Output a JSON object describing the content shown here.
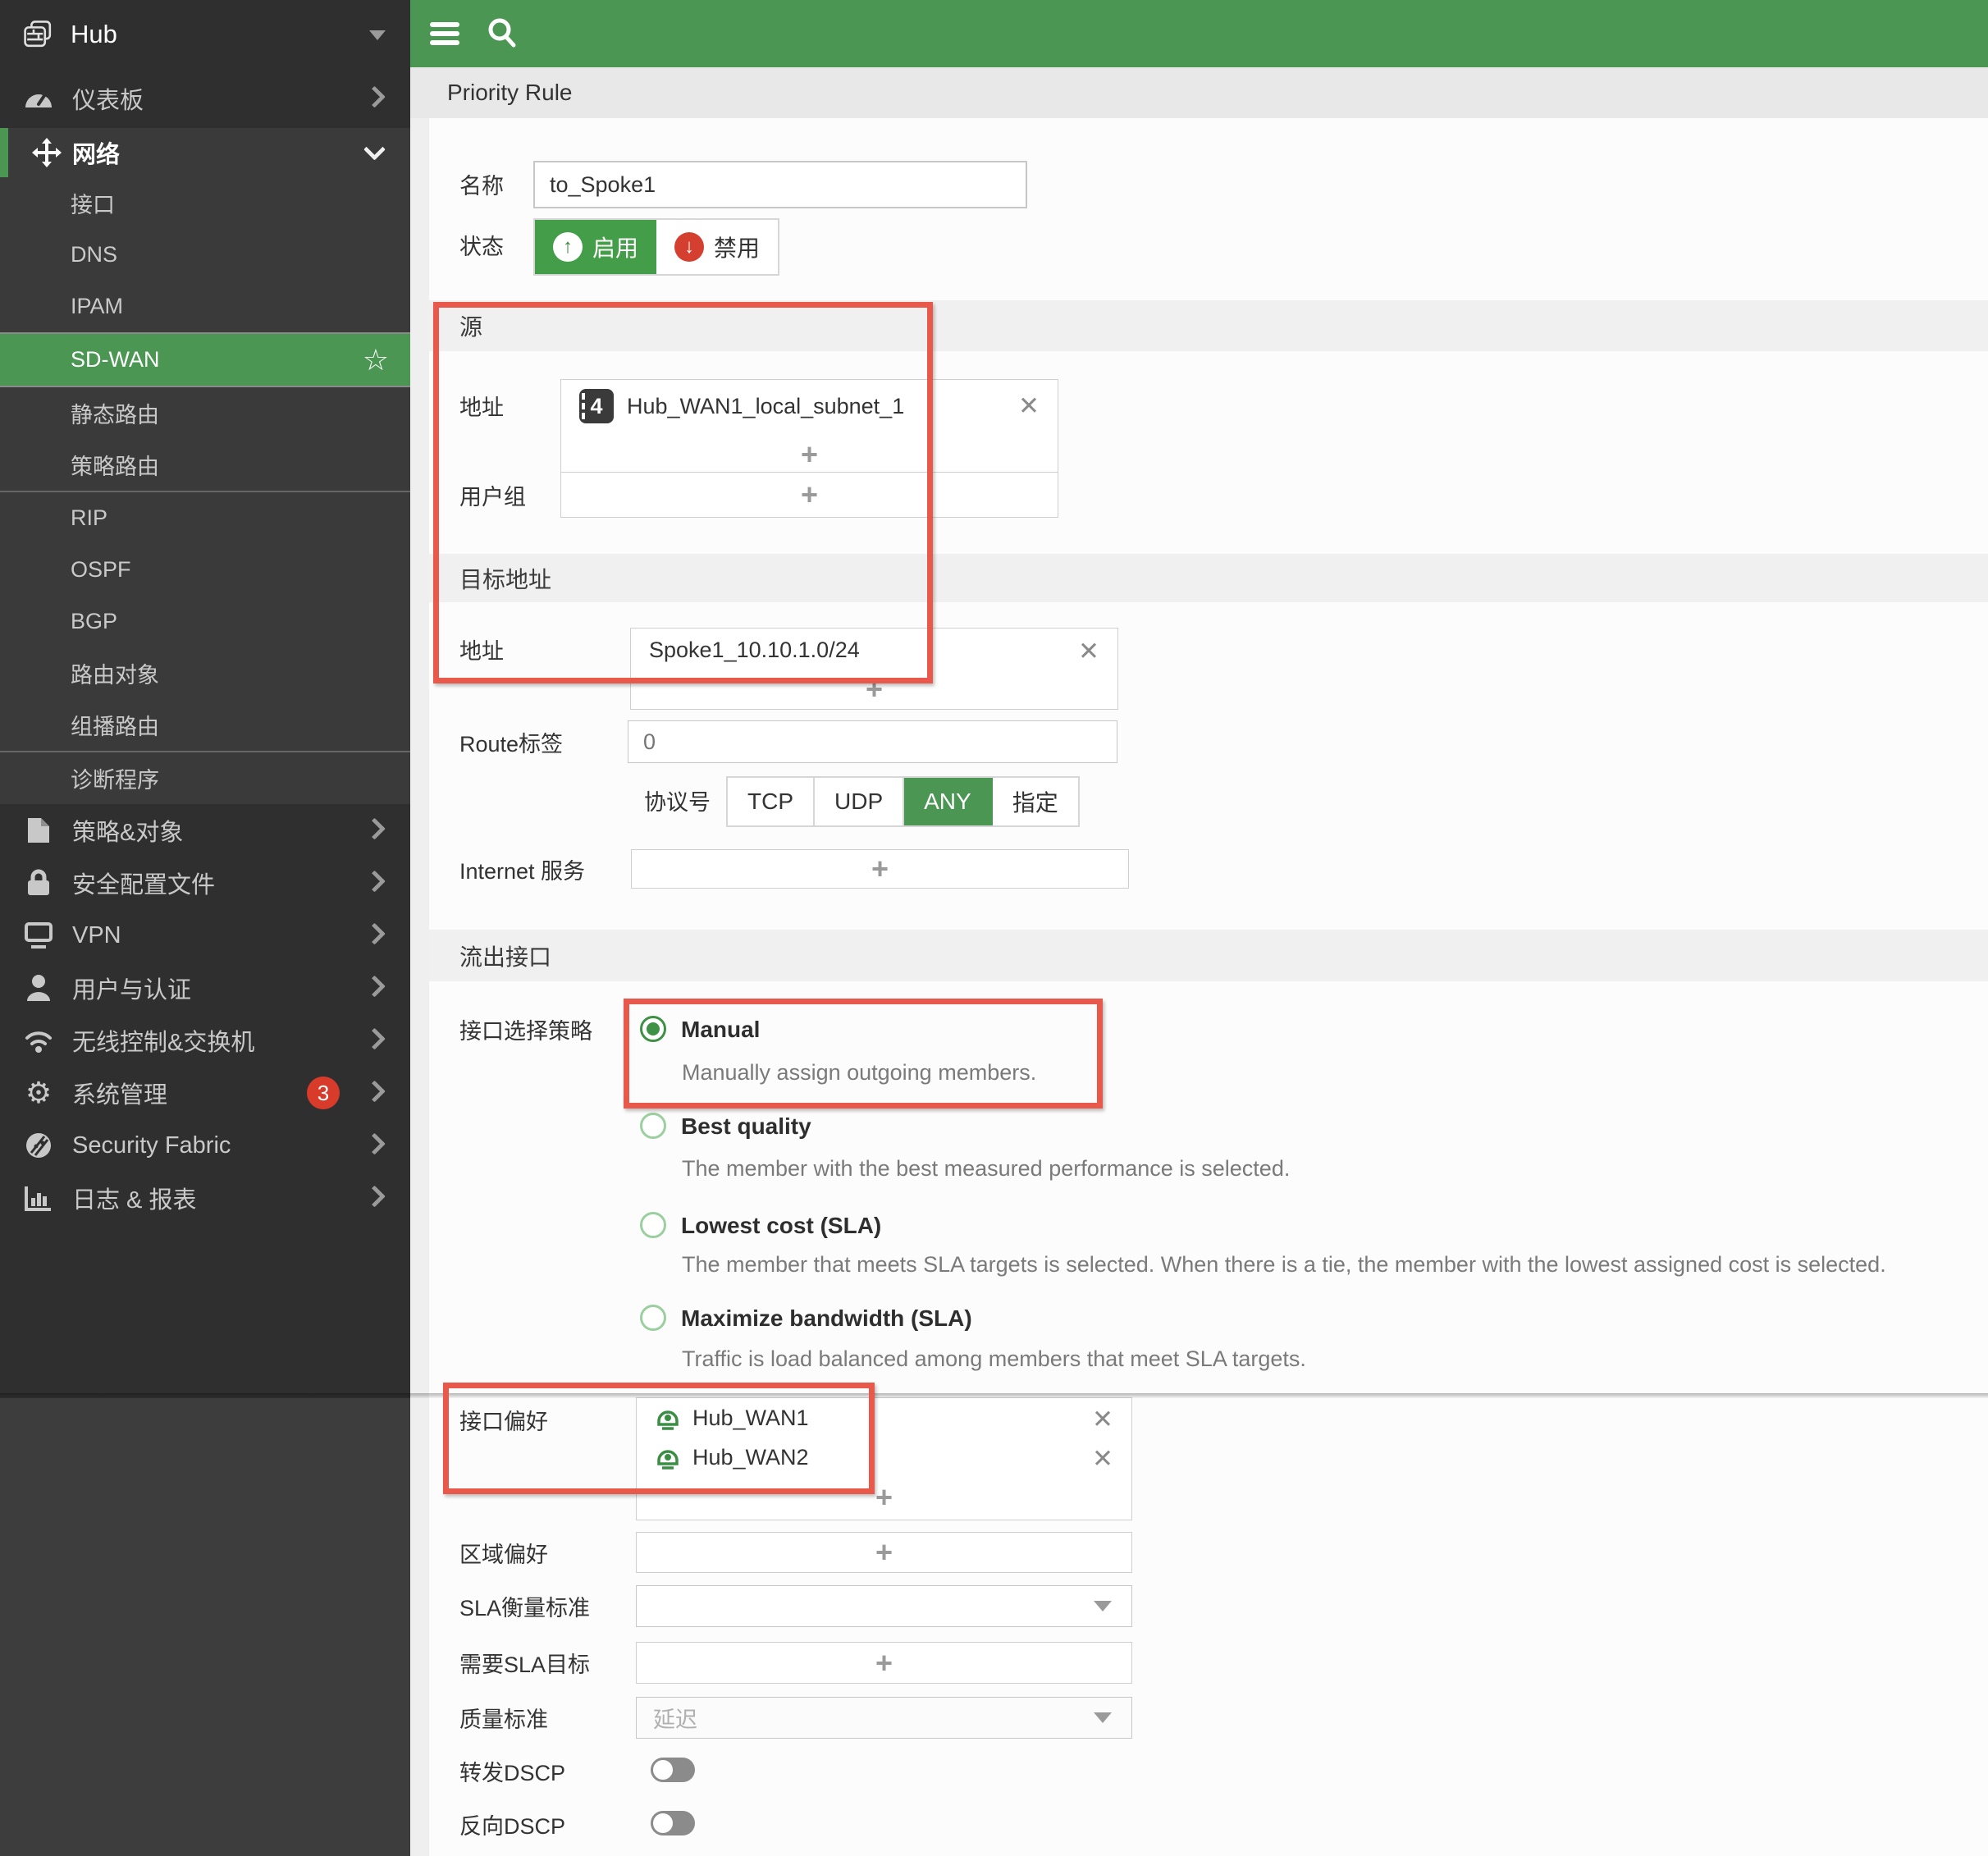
{
  "colors": {
    "accent_green": "#4a9652",
    "badge_red": "#d93b2b",
    "annotation_red": "#e8594b",
    "enable_green": "#449d48",
    "disable_red": "#d43f2f"
  },
  "topbar": {
    "breadcrumb": "Priority Rule"
  },
  "sidebar": {
    "hub": {
      "label": "Hub"
    },
    "dashboard": {
      "label": "仪表板"
    },
    "network": {
      "label": "网络",
      "children": [
        {
          "label": "接口"
        },
        {
          "label": "DNS"
        },
        {
          "label": "IPAM"
        },
        {
          "label": "SD-WAN",
          "selected": true
        },
        {
          "label": "静态路由"
        },
        {
          "label": "策略路由"
        },
        {
          "label": "RIP"
        },
        {
          "label": "OSPF"
        },
        {
          "label": "BGP"
        },
        {
          "label": "路由对象"
        },
        {
          "label": "组播路由"
        },
        {
          "label": "诊断程序"
        }
      ]
    },
    "items": [
      {
        "label": "策略&对象"
      },
      {
        "label": "安全配置文件"
      },
      {
        "label": "VPN"
      },
      {
        "label": "用户与认证"
      },
      {
        "label": "无线控制&交换机"
      },
      {
        "label": "系统管理",
        "badge": "3"
      },
      {
        "label": "Security Fabric"
      },
      {
        "label": "日志 & 报表"
      }
    ]
  },
  "form": {
    "name": {
      "label": "名称",
      "value": "to_Spoke1"
    },
    "status": {
      "label": "状态",
      "enable": "启用",
      "disable": "禁用",
      "selected": "启用"
    },
    "source": {
      "header": "源",
      "address": {
        "label": "地址",
        "items": [
          {
            "icon_text": "4",
            "text": "Hub_WAN1_local_subnet_1"
          }
        ]
      },
      "user_group": {
        "label": "用户组"
      }
    },
    "destination": {
      "header": "目标地址",
      "address": {
        "label": "地址",
        "items": [
          {
            "text": "Spoke1_10.10.1.0/24"
          }
        ]
      }
    },
    "route_tag": {
      "label": "Route标签",
      "placeholder": "0"
    },
    "protocol": {
      "label": "协议号",
      "options": [
        {
          "label": "TCP",
          "selected": false
        },
        {
          "label": "UDP",
          "selected": false
        },
        {
          "label": "ANY",
          "selected": true
        },
        {
          "label": "指定",
          "selected": false
        }
      ]
    },
    "internet_service": {
      "label": "Internet 服务"
    },
    "outgoing": {
      "header": "流出接口"
    },
    "strategy": {
      "label": "接口选择策略",
      "options": [
        {
          "label": "Manual",
          "desc": "Manually assign outgoing members.",
          "selected": true
        },
        {
          "label": "Best quality",
          "desc": "The member with the best measured performance is selected.",
          "selected": false
        },
        {
          "label": "Lowest cost (SLA)",
          "desc": "The member that meets SLA targets is selected. When there is a tie, the member with the lowest assigned cost is selected.",
          "selected": false
        },
        {
          "label": "Maximize bandwidth (SLA)",
          "desc": "Traffic is load balanced among members that meet SLA targets.",
          "selected": false
        }
      ]
    },
    "interface_preference": {
      "label": "接口偏好",
      "members": [
        {
          "text": "Hub_WAN1"
        },
        {
          "text": "Hub_WAN2"
        }
      ]
    },
    "zone_preference": {
      "label": "区域偏好"
    },
    "sla_measure": {
      "label": "SLA衡量标准",
      "value": ""
    },
    "sla_targets": {
      "label": "需要SLA目标"
    },
    "quality_criteria": {
      "label": "质量标准",
      "value": "延迟"
    },
    "forward_dscp": {
      "label": "转发DSCP",
      "on": false
    },
    "reverse_dscp": {
      "label": "反向DSCP",
      "on": false
    }
  }
}
